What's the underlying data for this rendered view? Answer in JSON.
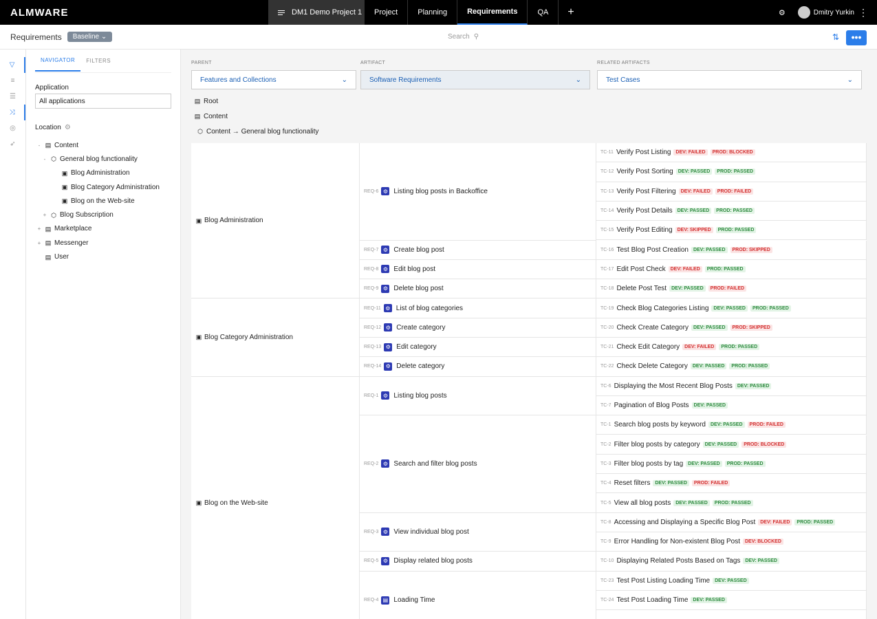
{
  "app": {
    "logo": "ALMWARE",
    "project": "DM1 Demo Project 1",
    "tabs": [
      "Project",
      "Planning",
      "Requirements",
      "QA"
    ],
    "active_tab": "Requirements",
    "user": "Dmitry Yurkin"
  },
  "subbar": {
    "title": "Requirements",
    "baseline": "Baseline",
    "search_placeholder": "Search"
  },
  "nav": {
    "tabs": [
      "NAVIGATOR",
      "FILTERS"
    ],
    "application_label": "Application",
    "application_value": "All applications",
    "location_label": "Location",
    "tree": [
      {
        "label": "Content",
        "level": 0,
        "toggle": "-",
        "icon": "box"
      },
      {
        "label": "General blog functionality",
        "level": 1,
        "toggle": "-",
        "icon": "cube"
      },
      {
        "label": "Blog Administration",
        "level": 2,
        "toggle": "",
        "icon": "doc"
      },
      {
        "label": "Blog Category Administration",
        "level": 2,
        "toggle": "",
        "icon": "doc"
      },
      {
        "label": "Blog on the Web-site",
        "level": 2,
        "toggle": "",
        "icon": "doc"
      },
      {
        "label": "Blog Subscription",
        "level": 1,
        "toggle": "+",
        "icon": "cube"
      },
      {
        "label": "Marketplace",
        "level": 0,
        "toggle": "+",
        "icon": "box"
      },
      {
        "label": "Messenger",
        "level": 0,
        "toggle": "+",
        "icon": "box"
      },
      {
        "label": "User",
        "level": 0,
        "toggle": "",
        "icon": "box"
      }
    ]
  },
  "selectors": {
    "parent_label": "PARENT",
    "parent_value": "Features and Collections",
    "artifact_label": "ARTIFACT",
    "artifact_value": "Software Requirements",
    "related_label": "RELATED ARTIFACTS",
    "related_value": "Test Cases"
  },
  "crumbs": [
    "Root",
    "Content",
    "Content → General blog functionality"
  ],
  "features": [
    {
      "name": "Blog Administration",
      "reqs": [
        {
          "code": "REQ-6",
          "name": "Listing blog posts in Backoffice",
          "tests": [
            {
              "code": "TC-11",
              "name": "Verify Post Listing",
              "st": [
                [
                  "DEV: FAILED",
                  "fail"
                ],
                [
                  "PROD: BLOCKED",
                  "fail"
                ]
              ]
            },
            {
              "code": "TC-12",
              "name": "Verify Post Sorting",
              "st": [
                [
                  "DEV: PASSED",
                  "pass"
                ],
                [
                  "PROD: PASSED",
                  "pass"
                ]
              ]
            },
            {
              "code": "TC-13",
              "name": "Verify Post Filtering",
              "st": [
                [
                  "DEV: FAILED",
                  "fail"
                ],
                [
                  "PROD: FAILED",
                  "fail"
                ]
              ]
            },
            {
              "code": "TC-14",
              "name": "Verify Post Details",
              "st": [
                [
                  "DEV: PASSED",
                  "pass"
                ],
                [
                  "PROD: PASSED",
                  "pass"
                ]
              ]
            },
            {
              "code": "TC-15",
              "name": "Verify Post Editing",
              "st": [
                [
                  "DEV: SKIPPED",
                  "fail"
                ],
                [
                  "PROD: PASSED",
                  "pass"
                ]
              ]
            }
          ]
        },
        {
          "code": "REQ-7",
          "name": "Create blog post",
          "tests": [
            {
              "code": "TC-16",
              "name": "Test Blog Post Creation",
              "st": [
                [
                  "DEV: PASSED",
                  "pass"
                ],
                [
                  "PROD: SKIPPED",
                  "fail"
                ]
              ]
            }
          ]
        },
        {
          "code": "REQ-8",
          "name": "Edit blog post",
          "tests": [
            {
              "code": "TC-17",
              "name": "Edit Post Check",
              "st": [
                [
                  "DEV: FAILED",
                  "fail"
                ],
                [
                  "PROD: PASSED",
                  "pass"
                ]
              ]
            }
          ]
        },
        {
          "code": "REQ-9",
          "name": "Delete blog post",
          "tests": [
            {
              "code": "TC-18",
              "name": "Delete Post Test",
              "st": [
                [
                  "DEV: PASSED",
                  "pass"
                ],
                [
                  "PROD: FAILED",
                  "fail"
                ]
              ]
            }
          ]
        }
      ]
    },
    {
      "name": "Blog Category Administration",
      "reqs": [
        {
          "code": "REQ-11",
          "name": "List of blog categories",
          "tests": [
            {
              "code": "TC-19",
              "name": "Check Blog Categories Listing",
              "st": [
                [
                  "DEV: PASSED",
                  "pass"
                ],
                [
                  "PROD: PASSED",
                  "pass"
                ]
              ]
            }
          ]
        },
        {
          "code": "REQ-12",
          "name": "Create category",
          "tests": [
            {
              "code": "TC-20",
              "name": "Check Create Category",
              "st": [
                [
                  "DEV: PASSED",
                  "pass"
                ],
                [
                  "PROD: SKIPPED",
                  "fail"
                ]
              ]
            }
          ]
        },
        {
          "code": "REQ-13",
          "name": "Edit category",
          "tests": [
            {
              "code": "TC-21",
              "name": "Check Edit Category",
              "st": [
                [
                  "DEV: FAILED",
                  "fail"
                ],
                [
                  "PROD: PASSED",
                  "pass"
                ]
              ]
            }
          ]
        },
        {
          "code": "REQ-14",
          "name": "Delete category",
          "tests": [
            {
              "code": "TC-22",
              "name": "Check Delete Category",
              "st": [
                [
                  "DEV: PASSED",
                  "pass"
                ],
                [
                  "PROD: PASSED",
                  "pass"
                ]
              ]
            }
          ]
        }
      ]
    },
    {
      "name": "Blog on the Web-site",
      "reqs": [
        {
          "code": "REQ-1",
          "name": "Listing blog posts",
          "tests": [
            {
              "code": "TC-6",
              "name": "Displaying the Most Recent Blog Posts",
              "st": [
                [
                  "DEV: PASSED",
                  "pass"
                ]
              ]
            },
            {
              "code": "TC-7",
              "name": "Pagination of Blog Posts",
              "st": [
                [
                  "DEV: PASSED",
                  "pass"
                ]
              ]
            }
          ]
        },
        {
          "code": "REQ-2",
          "name": "Search and filter blog posts",
          "tests": [
            {
              "code": "TC-1",
              "name": "Search blog posts by keyword",
              "st": [
                [
                  "DEV: PASSED",
                  "pass"
                ],
                [
                  "PROD: FAILED",
                  "fail"
                ]
              ]
            },
            {
              "code": "TC-2",
              "name": "Filter blog posts by category",
              "st": [
                [
                  "DEV: PASSED",
                  "pass"
                ],
                [
                  "PROD: BLOCKED",
                  "fail"
                ]
              ]
            },
            {
              "code": "TC-3",
              "name": "Filter blog posts by tag",
              "st": [
                [
                  "DEV: PASSED",
                  "pass"
                ],
                [
                  "PROD: PASSED",
                  "pass"
                ]
              ]
            },
            {
              "code": "TC-4",
              "name": "Reset filters",
              "st": [
                [
                  "DEV: PASSED",
                  "pass"
                ],
                [
                  "PROD: FAILED",
                  "fail"
                ]
              ]
            },
            {
              "code": "TC-5",
              "name": "View all blog posts",
              "st": [
                [
                  "DEV: PASSED",
                  "pass"
                ],
                [
                  "PROD: PASSED",
                  "pass"
                ]
              ]
            }
          ]
        },
        {
          "code": "REQ-3",
          "name": "View individual blog post",
          "tests": [
            {
              "code": "TC-8",
              "name": "Accessing and Displaying a Specific Blog Post",
              "st": [
                [
                  "DEV: FAILED",
                  "fail"
                ],
                [
                  "PROD: PASSED",
                  "pass"
                ]
              ]
            },
            {
              "code": "TC-9",
              "name": "Error Handling for Non-existent Blog Post",
              "st": [
                [
                  "DEV: BLOCKED",
                  "fail"
                ]
              ]
            }
          ]
        },
        {
          "code": "REQ-5",
          "name": "Display related blog posts",
          "tests": [
            {
              "code": "TC-10",
              "name": "Displaying Related Posts Based on Tags",
              "st": [
                [
                  "DEV: PASSED",
                  "pass"
                ]
              ]
            }
          ]
        },
        {
          "code": "REQ-4",
          "name": "Loading Time",
          "doc": true,
          "tests": [
            {
              "code": "TC-23",
              "name": "Test Post Listing Loading Time",
              "st": [
                [
                  "DEV: PASSED",
                  "pass"
                ]
              ]
            },
            {
              "code": "TC-24",
              "name": "Test Post Loading Time",
              "st": [
                [
                  "DEV: PASSED",
                  "pass"
                ]
              ]
            },
            {
              "code": "",
              "name": "",
              "st": []
            }
          ]
        }
      ]
    }
  ]
}
